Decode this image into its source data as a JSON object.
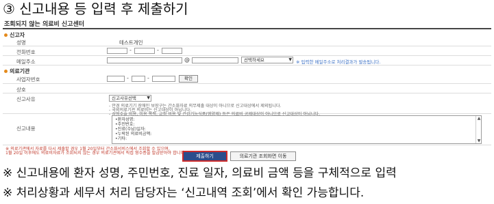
{
  "step_title": "③ 신고내용 등 입력 후 제출하기",
  "panel": {
    "title": "조회되지 않는 의료비 신고센터",
    "reporter": {
      "heading": "신고자",
      "name_label": "성명",
      "name_value": "테스트개인",
      "phone_label": "전화번호",
      "email_label": "메일주소",
      "at_sign": "@",
      "domain_select": "선택하세요",
      "email_note": "※ 입력한 메일주소로 처리결과가 발송됩니다."
    },
    "institution": {
      "heading": "의료기관",
      "bizno_label": "사업자번호",
      "confirm_button": "확인",
      "name_label": "상호"
    },
    "reason": {
      "label": "신고사유",
      "select_value": "신고사유선택",
      "notes": [
        "- 안경 의료기기 장애인 보장구는 간소화자료 의무제출 대상이 아니므로 신고대상에서 제외됩니다.",
        "- 국외의료기관 의료비는 신고대상이 아닙니다.",
        "- 성형수술 비용, 미용 목적, 교정 비용 및 건강기능식품(영양제) 등은 의료비 공제대상이 아니므로 신고대상이 아닙니다."
      ]
    },
    "content": {
      "label": "신고내용",
      "lines": [
        "•환자성명:",
        "•주민번호:",
        "•진료(수납)일자:",
        "•누락된 의료비금액:",
        "•기타:"
      ]
    },
    "footnotes": [
      "※ 의료기관에서 자료를 다시 제출할 경우 1월 20일부터 간소화서비스에서 조회할 수 있으며,",
      "   1월 20일 이후에도 의료비자료가 조회되지 않는 경우 의료기관에서 직접 영수증을 발급받아야 합니다."
    ],
    "submit_button": "제출하기",
    "lookup_button": "의료기관 조회화면 이동"
  },
  "bottom_notes": [
    "※  신고내용에 환자 성명, 주민번호, 진료 일자, 의료비 금액 등을 구체적으로 입력",
    "※  처리상황과 세무서 처리 담당자는 ‘신고내역 조회’에서 확인 가능합니다."
  ],
  "colors": {
    "section_dot": "#e48a1c",
    "submit_bg": "#2b4d8c",
    "highlight_border": "#cc2a2a",
    "note_blue": "#3a6fc4",
    "note_red": "#c0392b"
  },
  "icons": {
    "select_arrow": "dropdown-arrow-icon",
    "scroll_up": "scroll-up-icon",
    "scroll_down": "scroll-down-icon"
  }
}
